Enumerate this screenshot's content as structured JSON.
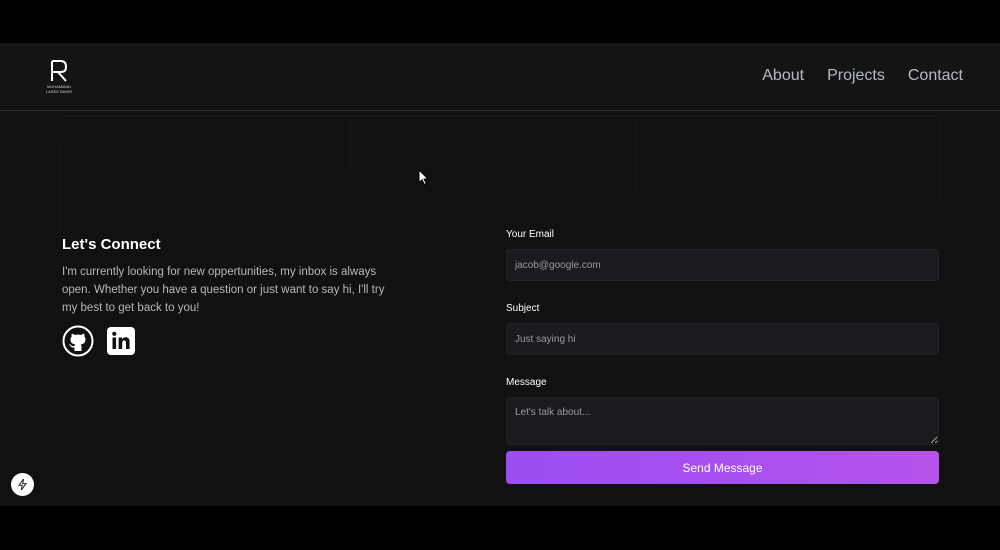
{
  "nav": {
    "logo_name_line1": "MUHAMMAD",
    "logo_name_line2": "LAREE BAKIR",
    "links": [
      "About",
      "Projects",
      "Contact"
    ]
  },
  "connect": {
    "heading": "Let's Connect",
    "body": "I'm currently looking for new oppertunities, my inbox is always open. Whether you have a question or just want to say hi, I'll try my best to get back to you!",
    "social_icons": [
      "github-icon",
      "linkedin-icon"
    ]
  },
  "form": {
    "email_label": "Your Email",
    "email_placeholder": "jacob@google.com",
    "subject_label": "Subject",
    "subject_placeholder": "Just saying hi",
    "message_label": "Message",
    "message_placeholder": "Let's talk about...",
    "send_label": "Send Message"
  },
  "colors": {
    "background": "#111111",
    "accent_start": "#9b4ef2",
    "accent_end": "#b753ec",
    "nav_text": "#b5b9c2"
  }
}
